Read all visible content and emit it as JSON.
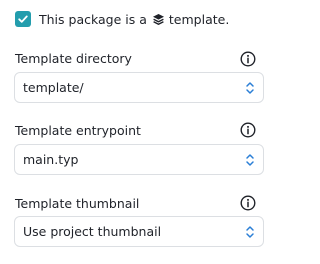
{
  "package": {
    "checkbox_checked": true,
    "label_prefix": "This package is a",
    "label_suffix": "template.",
    "inline_icon": "layers-icon"
  },
  "fields": [
    {
      "label": "Template directory",
      "value": "template/",
      "info_icon": "info-icon",
      "chevron_icon": "updown-chevron-icon"
    },
    {
      "label": "Template entrypoint",
      "value": "main.typ",
      "info_icon": "info-icon",
      "chevron_icon": "updown-chevron-icon"
    },
    {
      "label": "Template thumbnail",
      "value": "Use project thumbnail",
      "info_icon": "info-icon",
      "chevron_icon": "updown-chevron-icon"
    }
  ],
  "colors": {
    "accent": "#239dad",
    "text": "#1f2229",
    "border": "#dcdfe3",
    "chevron": "#2b7fd6"
  }
}
